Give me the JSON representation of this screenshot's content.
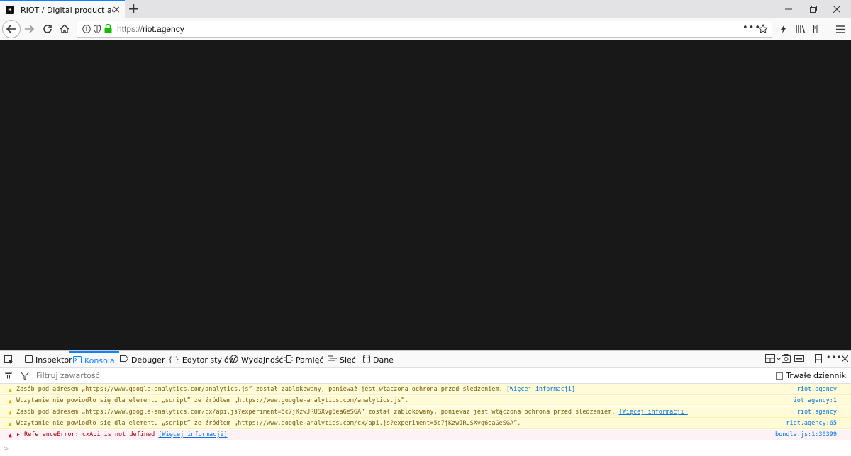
{
  "browser": {
    "tab_title": "RIOT / Digital product agency",
    "favicon_text": "R",
    "url_protocol": "https://",
    "url_host": "riot.agency"
  },
  "devtools": {
    "tabs": [
      {
        "label": "Inspektor",
        "icon": "inspector-icon"
      },
      {
        "label": "Konsola",
        "icon": "console-icon"
      },
      {
        "label": "Debuger",
        "icon": "debugger-icon"
      },
      {
        "label": "Edytor stylów",
        "icon": "style-editor-icon"
      },
      {
        "label": "Wydajność",
        "icon": "performance-icon"
      },
      {
        "label": "Pamięć",
        "icon": "memory-icon"
      },
      {
        "label": "Sieć",
        "icon": "network-icon"
      },
      {
        "label": "Dane",
        "icon": "storage-icon"
      }
    ],
    "filter_placeholder": "Filtruj zawartość",
    "persist_logs_label": "Trwałe dzienniki",
    "messages": [
      {
        "level": "warn",
        "text": "Zasób pod adresem „https://www.google-analytics.com/analytics.js” został zablokowany, ponieważ jest włączona ochrona przed śledzeniem.",
        "link": "[Więcej informacji]",
        "source": "riot.agency"
      },
      {
        "level": "warn",
        "text": "Wczytanie nie powiodło się dla elementu „script” ze źródłem „https://www.google-analytics.com/analytics.js”.",
        "link": "",
        "source": "riot.agency:1"
      },
      {
        "level": "warn",
        "text": "Zasób pod adresem „https://www.google-analytics.com/cx/api.js?experiment=5c7jKzwJRUSXvg6eaGeSGA” został zablokowany, ponieważ jest włączona ochrona przed śledzeniem.",
        "link": "[Więcej informacji]",
        "source": "riot.agency"
      },
      {
        "level": "warn",
        "text": "Wczytanie nie powiodło się dla elementu „script” ze źródłem „https://www.google-analytics.com/cx/api.js?experiment=5c7jKzwJRUSXvg6eaGeSGA”.",
        "link": "",
        "source": "riot.agency:65"
      },
      {
        "level": "error",
        "text": "ReferenceError: cxApi is not defined",
        "link": "[Więcej informacji]",
        "source": "bundle.js:1:30399"
      }
    ],
    "prompt": "»"
  },
  "colors": {
    "accent": "#0a84ff",
    "content_bg": "#181818",
    "warn_bg": "#fffbd6",
    "error_bg": "#fdf2f5"
  }
}
